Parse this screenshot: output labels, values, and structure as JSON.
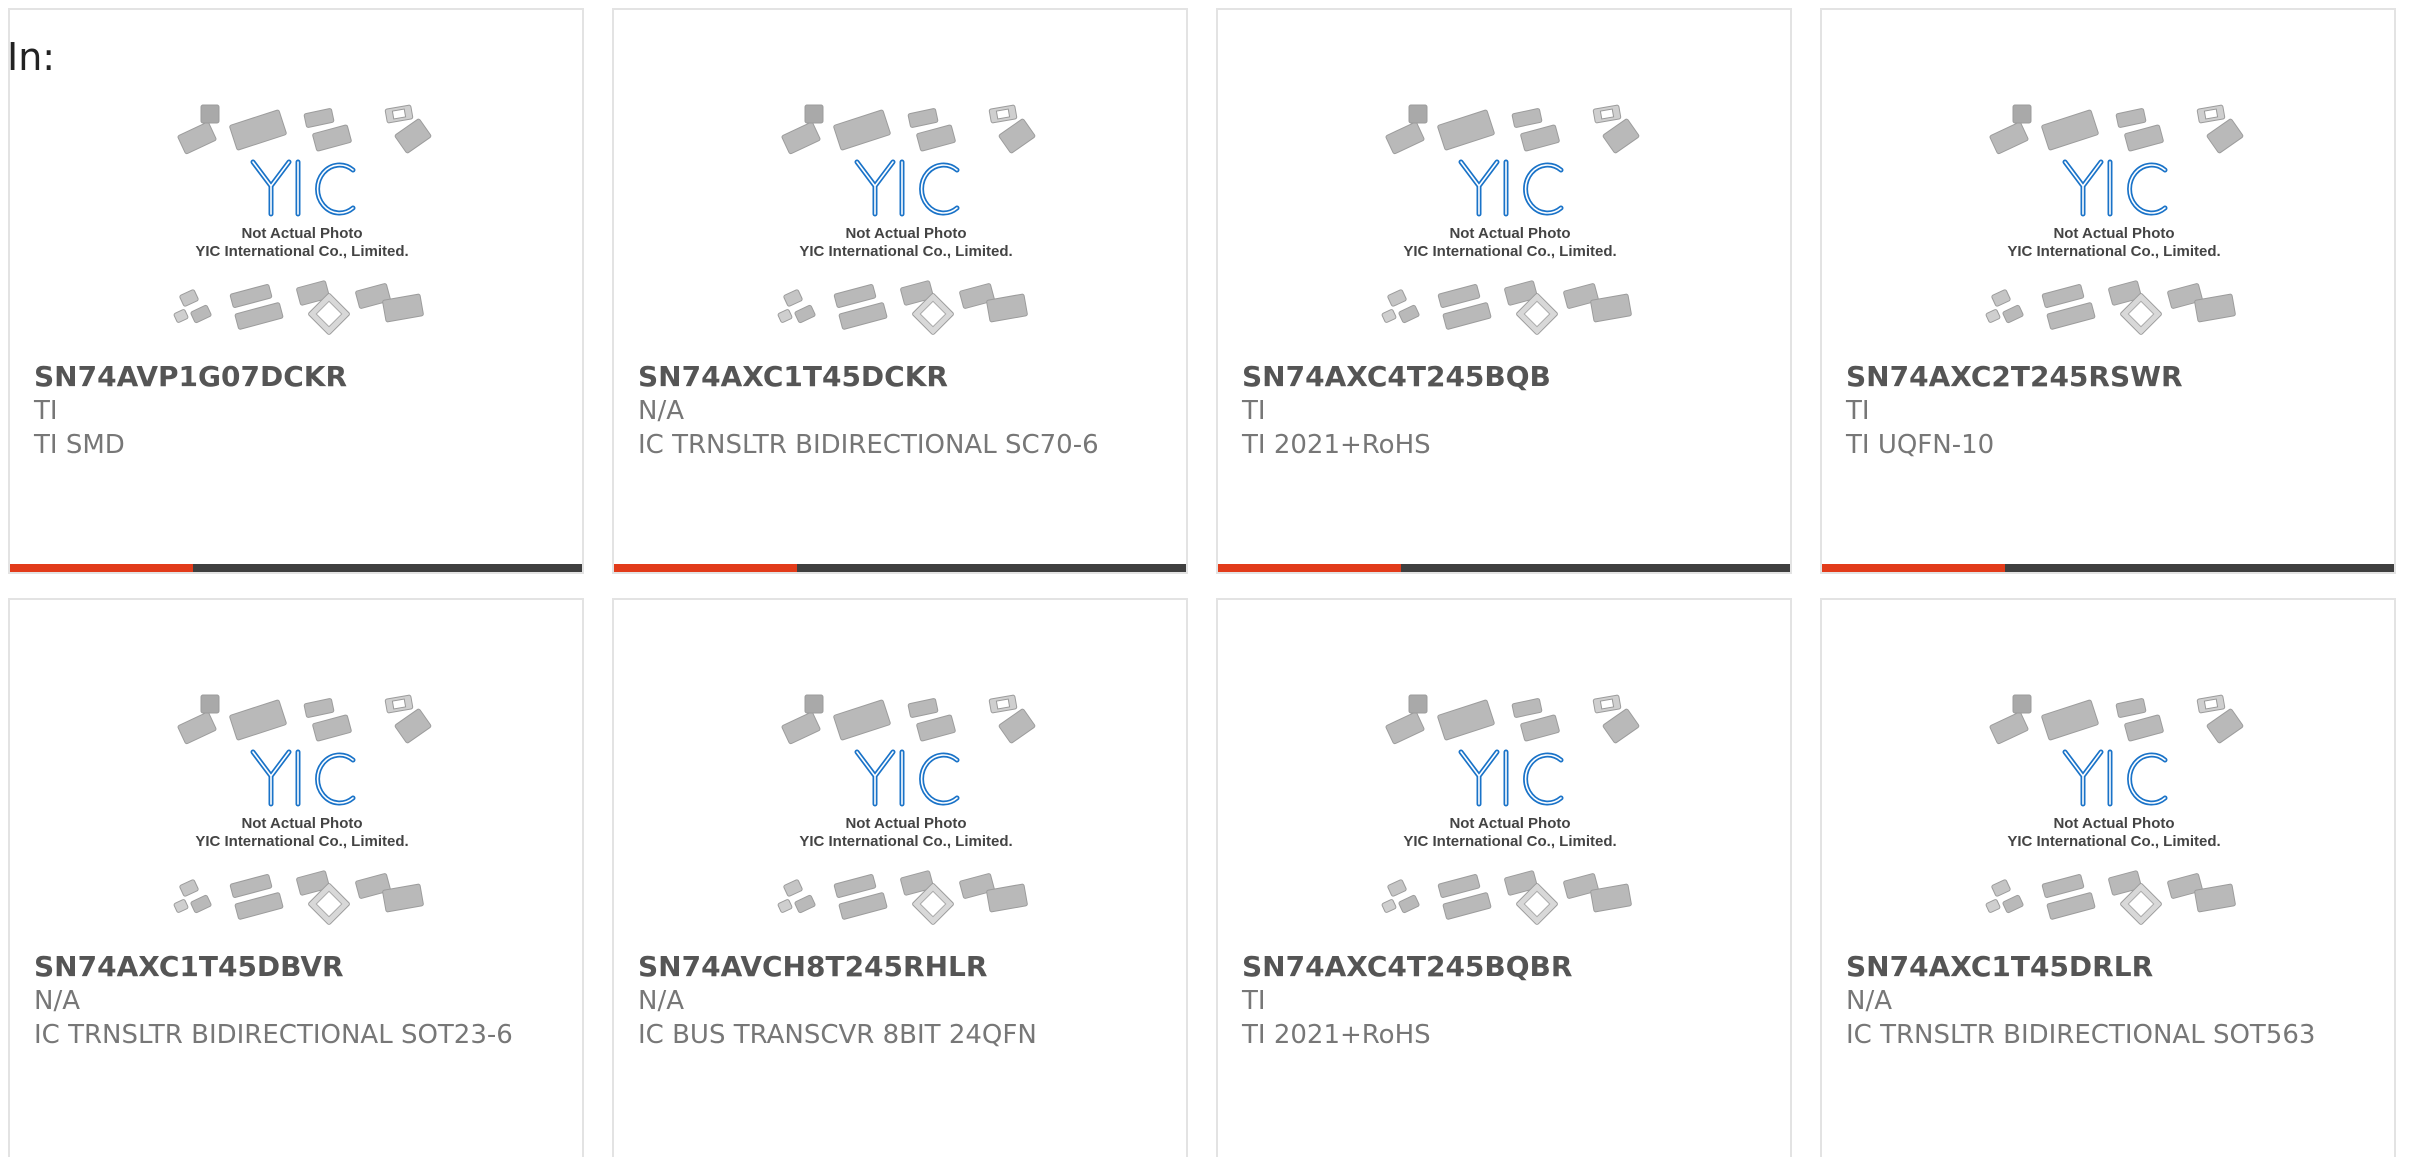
{
  "intro_label": "In:",
  "photo": {
    "brand": "YIC",
    "caption_line1": "Not Actual Photo",
    "caption_line2": "YIC International Co., Limited."
  },
  "colors": {
    "accent": "#e23b1a",
    "bar": "#3f3f3f",
    "logo_blue": "#1a73c8",
    "chip_gray": "#b9b9b9"
  },
  "products": [
    {
      "part": "SN74AVP1G07DCKR",
      "maker": "TI",
      "desc": "TI SMD",
      "has_bar": true
    },
    {
      "part": "SN74AXC1T45DCKR",
      "maker": "N/A",
      "desc": "IC TRNSLTR BIDIRECTIONAL SC70-6",
      "has_bar": true
    },
    {
      "part": "SN74AXC4T245BQB",
      "maker": "TI",
      "desc": "TI 2021+RoHS",
      "has_bar": true
    },
    {
      "part": "SN74AXC2T245RSWR",
      "maker": "TI",
      "desc": "TI UQFN-10",
      "has_bar": true
    },
    {
      "part": "SN74AXC1T45DBVR",
      "maker": "N/A",
      "desc": "IC TRNSLTR BIDIRECTIONAL SOT23-6",
      "has_bar": false
    },
    {
      "part": "SN74AVCH8T245RHLR",
      "maker": "N/A",
      "desc": "IC BUS TRANSCVR 8BIT 24QFN",
      "has_bar": false
    },
    {
      "part": "SN74AXC4T245BQBR",
      "maker": "TI",
      "desc": "TI 2021+RoHS",
      "has_bar": false
    },
    {
      "part": "SN74AXC1T45DRLR",
      "maker": "N/A",
      "desc": "IC TRNSLTR BIDIRECTIONAL SOT563",
      "has_bar": false
    }
  ]
}
